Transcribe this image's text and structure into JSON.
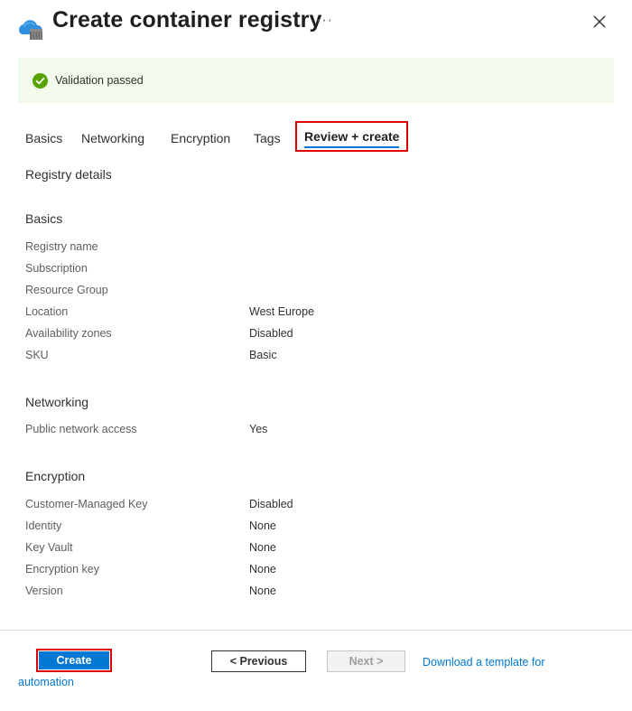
{
  "header": {
    "title": "Create container registry",
    "more_glyph": "···",
    "icon": "container-registry-cloud-icon",
    "close_icon": "close-icon"
  },
  "validation": {
    "text": "Validation passed",
    "icon": "check-circle-icon",
    "color": "#57a300"
  },
  "tabs": [
    {
      "label": "Basics",
      "active": false
    },
    {
      "label": "Networking",
      "active": false
    },
    {
      "label": "Encryption",
      "active": false
    },
    {
      "label": "Tags",
      "active": false
    },
    {
      "label": "Review + create",
      "active": true
    }
  ],
  "registry_details": {
    "title": "Registry details"
  },
  "basics": {
    "title": "Basics",
    "rows": [
      {
        "label": "Registry name",
        "value": ""
      },
      {
        "label": "Subscription",
        "value": ""
      },
      {
        "label": "Resource Group",
        "value": ""
      },
      {
        "label": "Location",
        "value": "West Europe"
      },
      {
        "label": "Availability zones",
        "value": "Disabled"
      },
      {
        "label": "SKU",
        "value": "Basic"
      }
    ]
  },
  "networking": {
    "title": "Networking",
    "rows": [
      {
        "label": "Public network access",
        "value": "Yes"
      }
    ]
  },
  "encryption": {
    "title": "Encryption",
    "rows": [
      {
        "label": "Customer-Managed Key",
        "value": "Disabled"
      },
      {
        "label": "Identity",
        "value": "None"
      },
      {
        "label": "Key Vault",
        "value": "None"
      },
      {
        "label": "Encryption key",
        "value": "None"
      },
      {
        "label": "Version",
        "value": "None"
      }
    ]
  },
  "footer": {
    "create_label": "Create",
    "previous_label": "< Previous",
    "next_label": "Next >",
    "download_label": "Download a template for automation"
  },
  "colors": {
    "accent": "#0078d4",
    "highlight": "#e00000",
    "banner_bg": "#f1faeb"
  }
}
